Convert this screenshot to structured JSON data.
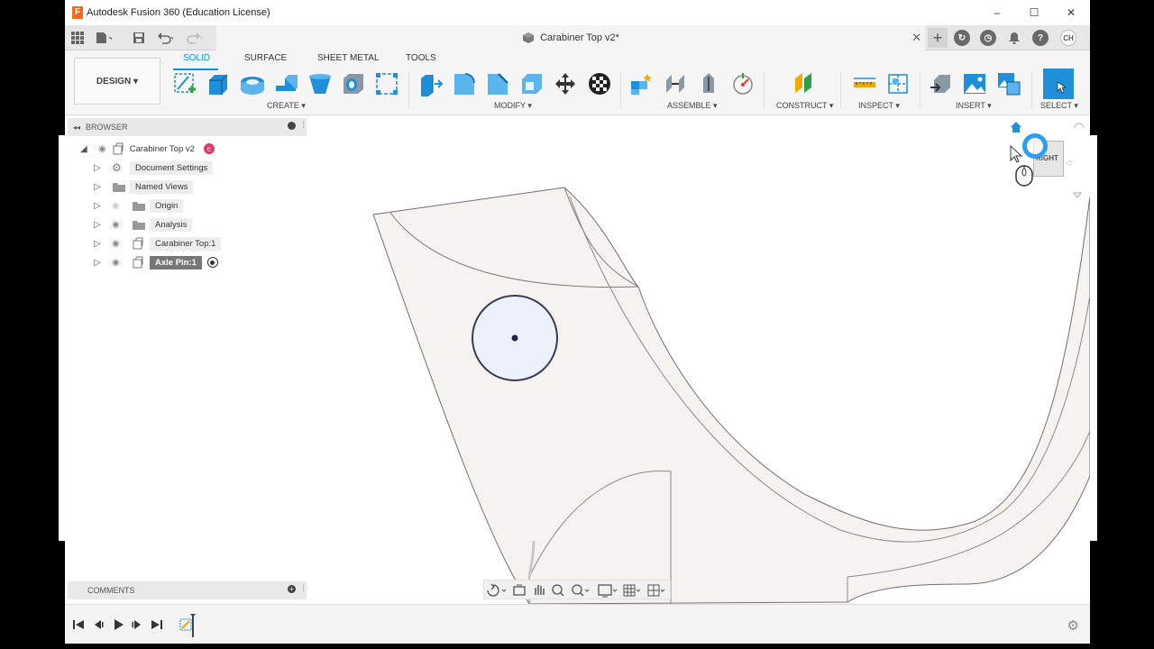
{
  "window": {
    "title": "Autodesk Fusion 360 (Education License)",
    "logo_letter": "F",
    "minimize_glyph": "–",
    "maximize_glyph": "☐",
    "close_glyph": "✕"
  },
  "document": {
    "tab_title": "Carabiner Top v2*",
    "close_glyph": "✕",
    "new_tab_glyph": "+",
    "user_initials": "CH"
  },
  "ribbon": {
    "workspace": "DESIGN ▾",
    "tabs": [
      "SOLID",
      "SURFACE",
      "SHEET METAL",
      "TOOLS"
    ],
    "active_tab": "SOLID",
    "groups": [
      "CREATE ▾",
      "MODIFY ▾",
      "ASSEMBLE ▾",
      "CONSTRUCT ▾",
      "INSPECT ▾",
      "INSERT ▾",
      "SELECT ▾"
    ]
  },
  "browser": {
    "title": "BROWSER",
    "root": "Carabiner Top v2",
    "items": [
      "Document Settings",
      "Named Views",
      "Origin",
      "Analysis",
      "Carabiner Top:1",
      "Axle Pin:1"
    ]
  },
  "comments": {
    "title": "COMMENTS"
  },
  "viewcube": {
    "face": "RIGHT"
  },
  "colors": {
    "accent": "#0696d7",
    "selection_blue": "#1e8fd8",
    "brand": "#f26b21"
  },
  "icons": [
    "apps-grid-icon",
    "file-icon",
    "save-icon",
    "undo-icon",
    "redo-icon",
    "home-icon",
    "settings-icon",
    "help-icon",
    "notification-icon"
  ]
}
